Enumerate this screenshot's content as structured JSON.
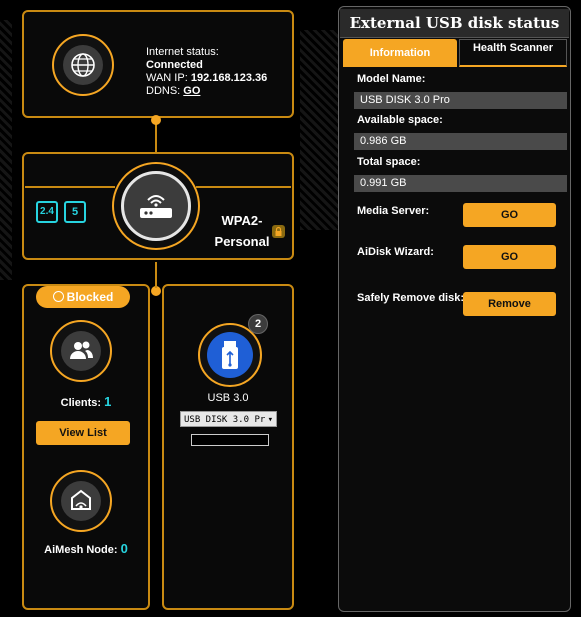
{
  "internet": {
    "status_label": "Internet status:",
    "status_value": "Connected",
    "wan_label": "WAN IP:",
    "wan_value": "192.168.123.36",
    "ddns_label": "DDNS:",
    "ddns_link": "GO"
  },
  "router": {
    "band_24": "2.4",
    "band_5": "5",
    "security_line1": "WPA2-",
    "security_line2": "Personal"
  },
  "clients": {
    "blocked_label": "Blocked",
    "label": "Clients:",
    "count": "1",
    "view_list": "View List",
    "aimesh_label": "AiMesh Node:",
    "aimesh_count": "0"
  },
  "usb": {
    "badge": "2",
    "label": "USB 3.0",
    "selected_device": "USB DISK 3.0 Pr"
  },
  "usb_status": {
    "title": "External USB disk status",
    "tabs": [
      "Information",
      "Health Scanner"
    ],
    "model_label": "Model Name:",
    "model_value": "USB DISK 3.0 Pro",
    "avail_label": "Available space:",
    "avail_value": "0.986 GB",
    "total_label": "Total space:",
    "total_value": "0.991 GB",
    "media_label": "Media Server:",
    "media_btn": "GO",
    "aidisk_label": "AiDisk Wizard:",
    "aidisk_btn": "GO",
    "remove_label": "Safely Remove disk:",
    "remove_btn": "Remove"
  },
  "colors": {
    "accent": "#f5a623",
    "count": "#27d4e0",
    "usb_blue": "#1f5fd6"
  }
}
